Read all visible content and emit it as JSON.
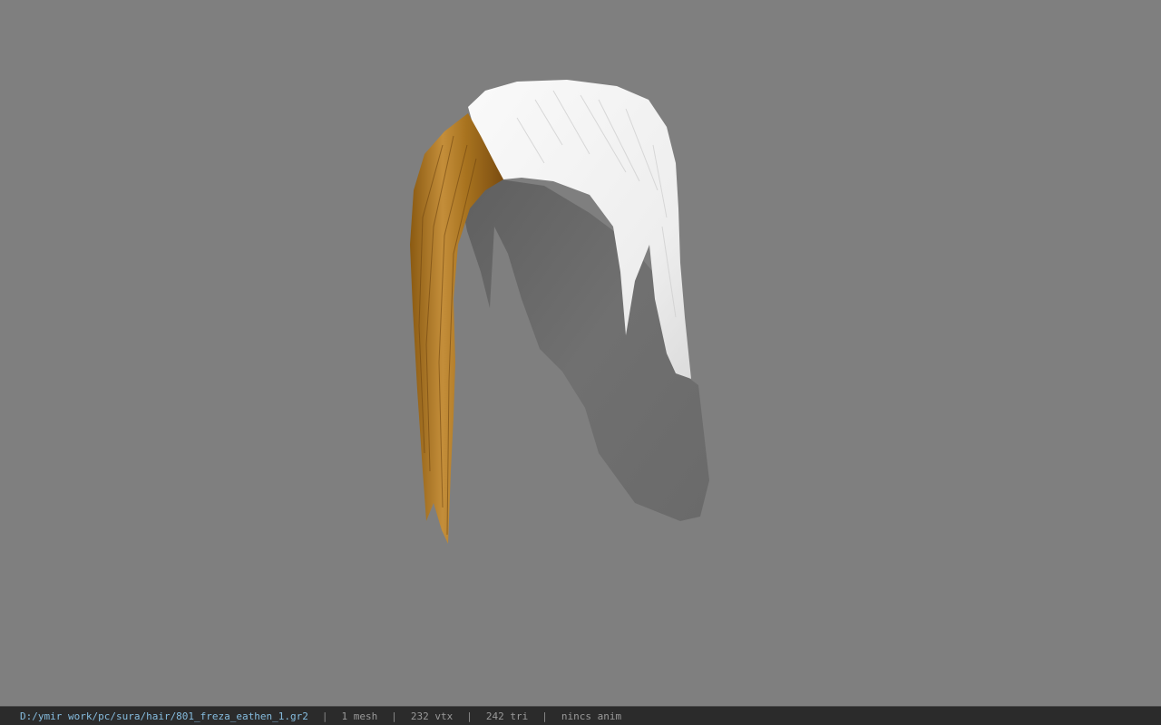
{
  "viewport": {
    "background_color": "#7f7f7f",
    "model": {
      "hair_colors": {
        "blond": "#b07a2a",
        "white": "#f2f2f2",
        "shadow": "#6b6b6b"
      }
    }
  },
  "status_bar": {
    "file_path": "D:/ymir work/pc/sura/hair/801_freza_eathen_1.gr2",
    "separator": "|",
    "mesh_count": "1 mesh",
    "vertex_count": "232 vtx",
    "triangle_count": "242 tri",
    "animation_status": "nincs anim",
    "path_color": "#86bde0",
    "text_color": "#9a9a9a",
    "background_color": "#2b2b2b"
  }
}
